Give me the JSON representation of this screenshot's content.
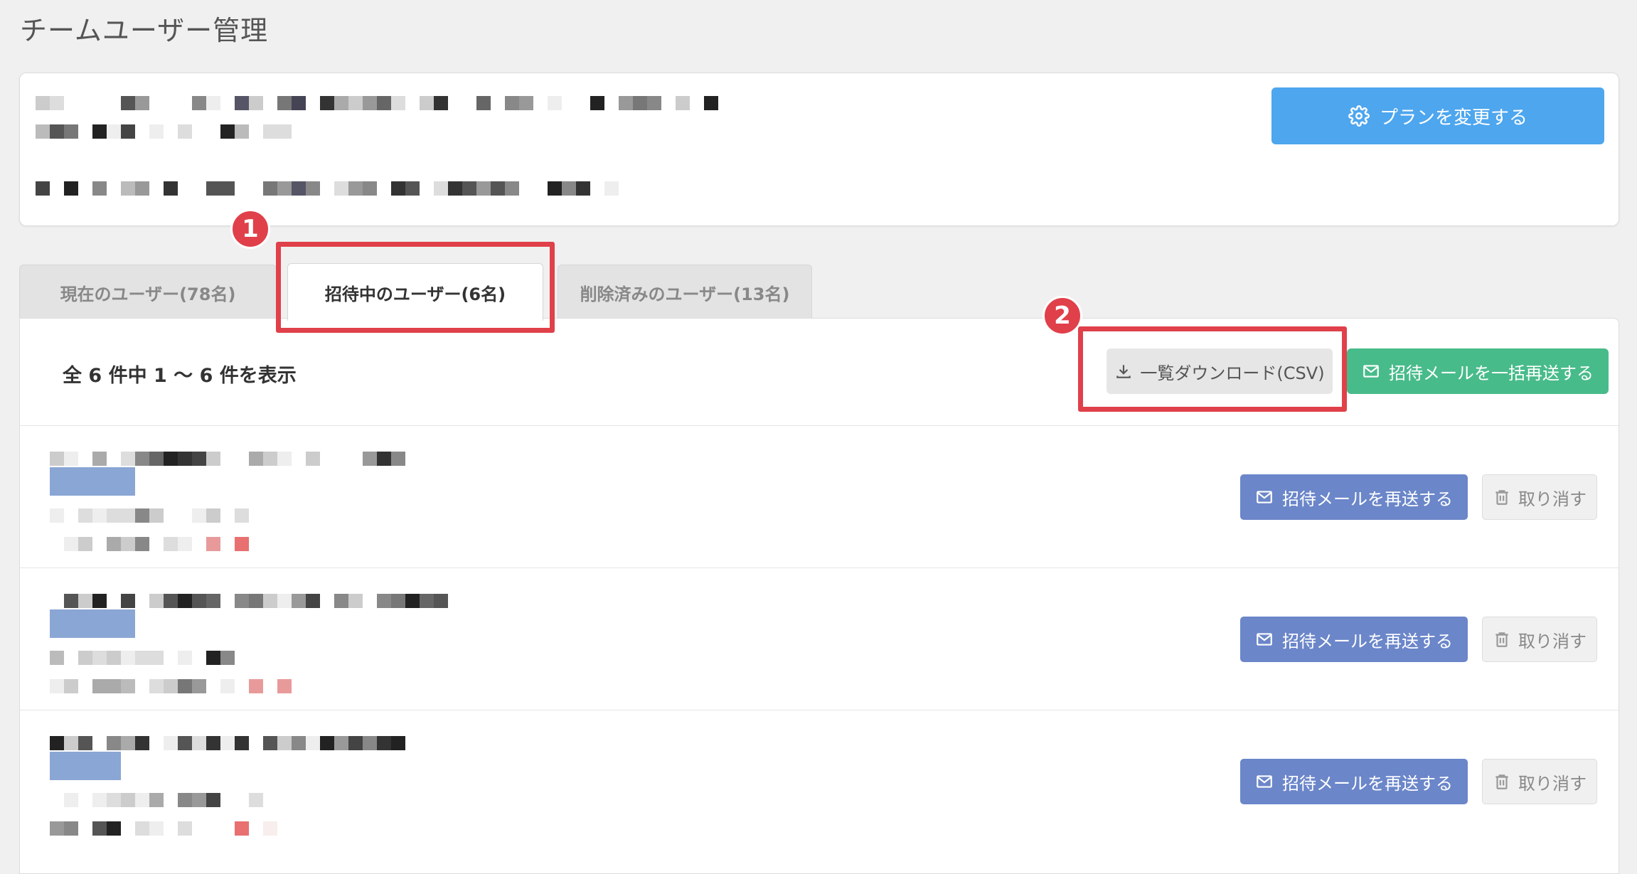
{
  "page": {
    "title": "チームユーザー管理"
  },
  "plan": {
    "change_button_label": "プランを変更する"
  },
  "tabs": [
    {
      "label": "現在のユーザー(78名)"
    },
    {
      "label": "招待中のユーザー(6名)"
    },
    {
      "label": "削除済みのユーザー(13名)"
    }
  ],
  "list": {
    "count_text": "全 6 件中 1 〜 6 件を表示",
    "download_csv_label": "一覧ダウンロード(CSV)",
    "resend_all_label": "招待メールを一括再送する"
  },
  "rows": [
    {
      "resend_label": "招待メールを再送する",
      "cancel_label": "取り消す"
    },
    {
      "resend_label": "招待メールを再送する",
      "cancel_label": "取り消す"
    },
    {
      "resend_label": "招待メールを再送する",
      "cancel_label": "取り消す"
    }
  ],
  "annotations": [
    {
      "number": "1"
    },
    {
      "number": "2"
    }
  ],
  "colors": {
    "plan_button": "#4da6ee",
    "resend_all": "#48bb8a",
    "row_resend": "#6b86c9",
    "annotation": "#e0404a"
  }
}
